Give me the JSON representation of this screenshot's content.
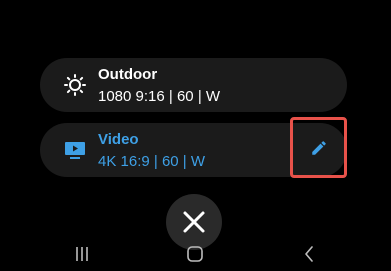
{
  "presets": [
    {
      "title": "Outdoor",
      "settings": "1080 9:16 | 60 | W",
      "icon": "sun-icon",
      "color": "#ffffff"
    },
    {
      "title": "Video",
      "settings": "4K 16:9 | 60 | W",
      "icon": "video-screen-icon",
      "color": "#3ea0e6",
      "selected": true
    }
  ],
  "colors": {
    "accent": "#3ea0e6",
    "highlight_border": "#e8524a",
    "card_background": "#1b1b1b"
  },
  "actions": {
    "edit_icon": "pencil-icon",
    "close_icon": "close-icon"
  },
  "navigation": {
    "recents_icon": "recents-icon",
    "home_icon": "home-icon",
    "back_icon": "back-icon"
  }
}
